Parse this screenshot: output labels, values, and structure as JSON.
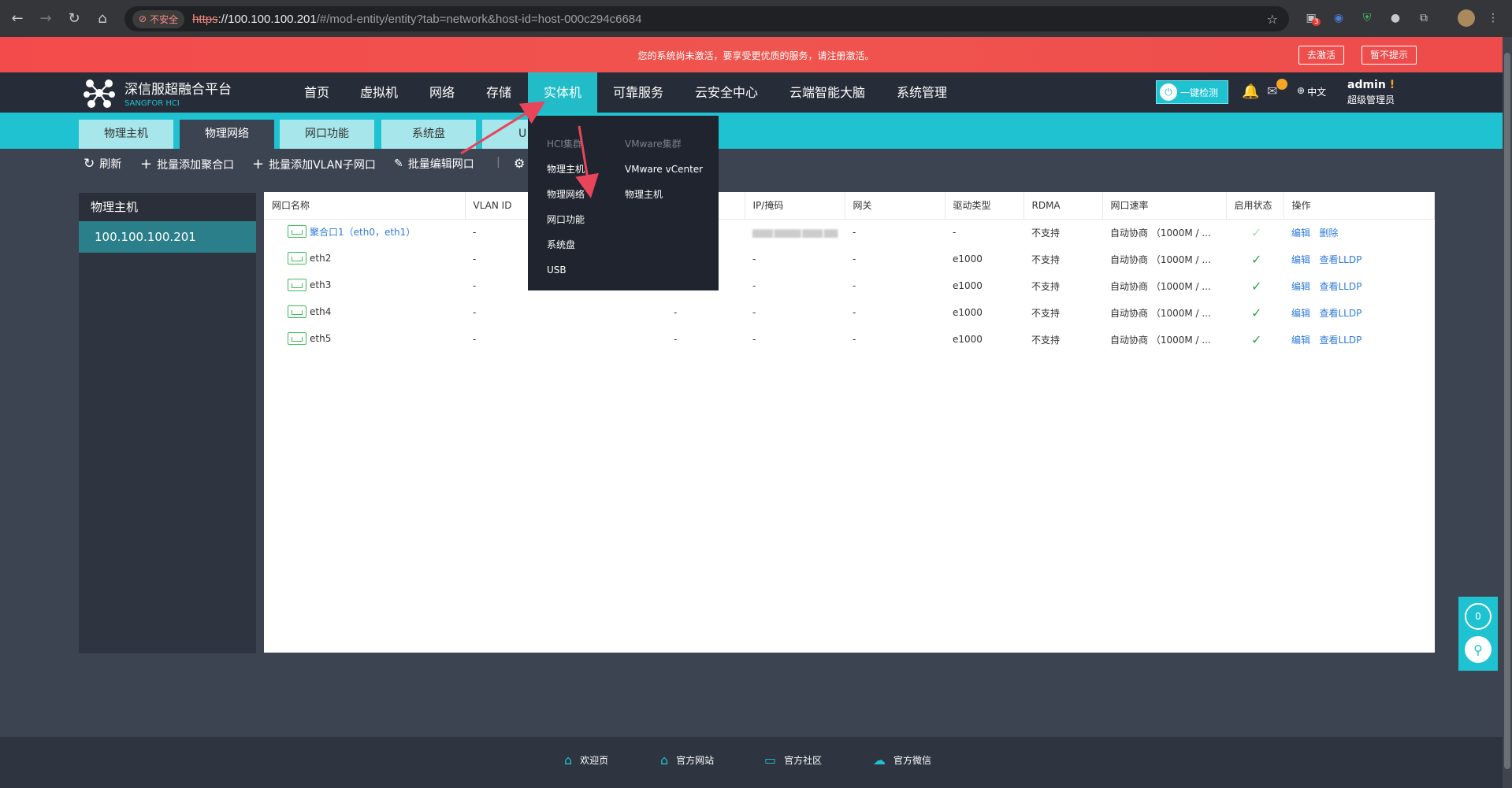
{
  "browser": {
    "insecure_label": "不安全",
    "url_https": "https",
    "url_host": "://100.100.100.201",
    "url_path": "/#/mod-entity/entity?tab=network&host-id=host-000c294c6684",
    "badge": "3"
  },
  "banner": {
    "text": "您的系统尚未激活，要享受更优质的服务，请注册激活。",
    "activate": "去激活",
    "dismiss": "暂不提示"
  },
  "header": {
    "logo_title": "深信服超融合平台",
    "logo_sub": "SANGFOR HCI",
    "menu": [
      "首页",
      "虚拟机",
      "网络",
      "存储",
      "实体机",
      "可靠服务",
      "云安全中心",
      "云端智能大脑",
      "系统管理"
    ],
    "health_check": "一键检测",
    "language": "中文",
    "admin_name": "admin",
    "admin_role": "超级管理员"
  },
  "subtabs": [
    "物理主机",
    "物理网络",
    "网口功能",
    "系统盘",
    "U"
  ],
  "toolbar": {
    "refresh": "刷新",
    "add_bond": "批量添加聚合口",
    "add_vlan": "批量添加VLAN子网口",
    "edit_nic": "批量编辑网口"
  },
  "sidebar": {
    "title": "物理主机",
    "host": "100.100.100.201"
  },
  "table": {
    "headers": [
      "网口名称",
      "VLAN ID",
      "",
      "IP/掩码",
      "网关",
      "驱动类型",
      "RDMA",
      "网口速率",
      "启用状态",
      "操作"
    ],
    "rows": [
      {
        "name": "聚合口1（eth0，eth1）",
        "vlan": "-",
        "mid": "",
        "ip": "▆▆▆ ▆▆▆▆ ▆▆▆ ▆▆",
        "gw": "-",
        "driver": "-",
        "rdma": "不支持",
        "speed": "自动协商 （1000M / ...",
        "op1": "编辑",
        "op2": "删除"
      },
      {
        "name": "eth2",
        "vlan": "-",
        "mid": "",
        "ip": "-",
        "gw": "-",
        "driver": "e1000",
        "rdma": "不支持",
        "speed": "自动协商 （1000M / ...",
        "op1": "编辑",
        "op2": "查看LLDP"
      },
      {
        "name": "eth3",
        "vlan": "-",
        "mid": "",
        "ip": "-",
        "gw": "-",
        "driver": "e1000",
        "rdma": "不支持",
        "speed": "自动协商 （1000M / ...",
        "op1": "编辑",
        "op2": "查看LLDP"
      },
      {
        "name": "eth4",
        "vlan": "-",
        "mid": "-",
        "ip": "-",
        "gw": "-",
        "driver": "e1000",
        "rdma": "不支持",
        "speed": "自动协商 （1000M / ...",
        "op1": "编辑",
        "op2": "查看LLDP"
      },
      {
        "name": "eth5",
        "vlan": "-",
        "mid": "-",
        "ip": "-",
        "gw": "-",
        "driver": "e1000",
        "rdma": "不支持",
        "speed": "自动协商 （1000M / ...",
        "op1": "编辑",
        "op2": "查看LLDP"
      }
    ]
  },
  "dropdown": {
    "col1": [
      "HCI集群",
      "物理主机",
      "物理网络",
      "网口功能",
      "系统盘",
      "USB"
    ],
    "col2": [
      "VMware集群",
      "VMware vCenter",
      "物理主机"
    ]
  },
  "float": {
    "count": "0"
  },
  "footer": [
    "欢迎页",
    "官方网站",
    "官方社区",
    "官方微信"
  ],
  "colors": {
    "accent": "#1ec2d0",
    "banner": "#f34b4b",
    "nav": "#272d38",
    "link": "#2f7bd8",
    "check": "#25a84a"
  }
}
